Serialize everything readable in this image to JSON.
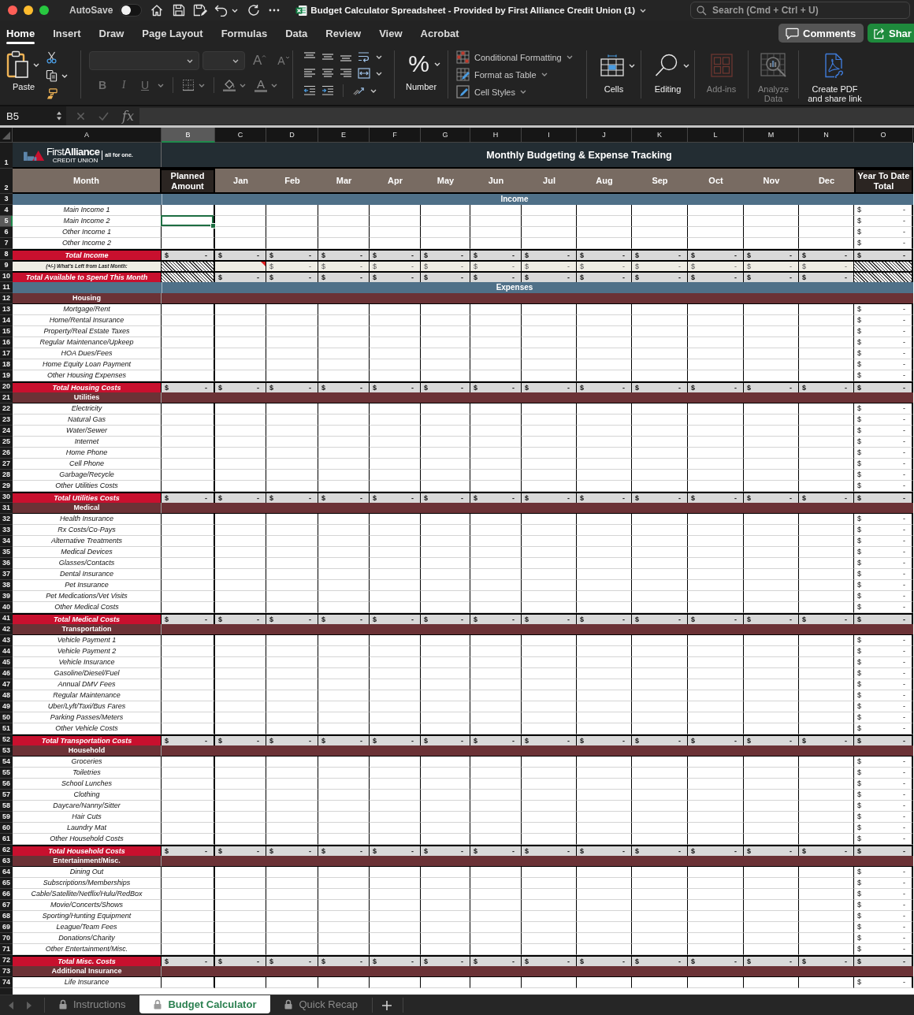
{
  "window": {
    "autosave": {
      "label": "AutoSave",
      "on": false
    },
    "title": "Budget Calculator Spreadsheet - Provided by First Alliance Credit Union (1)",
    "search": {
      "placeholder": "Search (Cmd + Ctrl + U)"
    }
  },
  "ribbon": {
    "tabs": [
      {
        "label": "Home",
        "selected": true
      },
      {
        "label": "Insert",
        "selected": false
      },
      {
        "label": "Draw",
        "selected": false
      },
      {
        "label": "Page Layout",
        "selected": false
      },
      {
        "label": "Formulas",
        "selected": false
      },
      {
        "label": "Data",
        "selected": false
      },
      {
        "label": "Review",
        "selected": false
      },
      {
        "label": "View",
        "selected": false
      },
      {
        "label": "Acrobat",
        "selected": false
      }
    ],
    "comments": "Comments",
    "share": "Shar",
    "paste": "Paste",
    "font": {
      "disabled": true,
      "grow": "A",
      "shrink": "A",
      "styles": [
        "B",
        "I",
        "U"
      ],
      "font_color_button": "A"
    },
    "number": {
      "symbol": "%",
      "label": "Number"
    },
    "styles": [
      {
        "kind": "conditional",
        "label": "Conditional Formatting"
      },
      {
        "kind": "table",
        "label": "Format as Table"
      },
      {
        "kind": "cell",
        "label": "Cell Styles"
      }
    ],
    "groups": [
      {
        "kind": "cells",
        "lines": [
          "Cells"
        ],
        "disabled": false
      },
      {
        "kind": "editing",
        "lines": [
          "Editing"
        ],
        "disabled": false
      },
      {
        "kind": "addins",
        "lines": [
          "Add-ins"
        ],
        "disabled": true
      },
      {
        "kind": "analyze",
        "lines": [
          "Analyze",
          "Data"
        ],
        "disabled": true
      },
      {
        "kind": "pdf",
        "lines": [
          "Create PDF",
          "and share link"
        ],
        "disabled": false
      }
    ]
  },
  "formula_bar": {
    "name_box": "B5",
    "function": "fx"
  },
  "sheet": {
    "columns": [
      {
        "letter": "A",
        "selected": false
      },
      {
        "letter": "B",
        "selected": true
      },
      {
        "letter": "C",
        "selected": false
      },
      {
        "letter": "D",
        "selected": false
      },
      {
        "letter": "E",
        "selected": false
      },
      {
        "letter": "F",
        "selected": false
      },
      {
        "letter": "G",
        "selected": false
      },
      {
        "letter": "H",
        "selected": false
      },
      {
        "letter": "I",
        "selected": false
      },
      {
        "letter": "J",
        "selected": false
      },
      {
        "letter": "K",
        "selected": false
      },
      {
        "letter": "L",
        "selected": false
      },
      {
        "letter": "M",
        "selected": false
      },
      {
        "letter": "N",
        "selected": false
      },
      {
        "letter": "O",
        "selected": false
      }
    ],
    "logo": {
      "wordmark": "First**Alliance**",
      "subtitle": "CREDIT UNION",
      "tagline": "all for one."
    },
    "title": "Monthly Budgeting & Expense Tracking",
    "headings": {
      "label": "Month",
      "planned": "Planned Amount",
      "months": [
        "Jan",
        "Feb",
        "Mar",
        "Apr",
        "May",
        "Jun",
        "Jul",
        "Aug",
        "Sep",
        "Oct",
        "Nov",
        "Dec"
      ],
      "total": "Year To Date Total"
    },
    "rows": [
      {
        "number": "1",
        "kind": "title",
        "selected": false
      },
      {
        "number": "2",
        "kind": "header",
        "selected": false
      },
      {
        "number": "3",
        "kind": "band",
        "selected": false,
        "label": "Income"
      },
      {
        "number": "4",
        "kind": "item",
        "selected": false,
        "label": "Main Income 1",
        "ytd": {
          "currency": "$",
          "amount": "-"
        }
      },
      {
        "number": "5",
        "kind": "item",
        "selected": true,
        "label": "Main Income 2",
        "ytd": {
          "currency": "$",
          "amount": "-"
        }
      },
      {
        "number": "6",
        "kind": "item",
        "selected": false,
        "label": "Other Income 1",
        "ytd": {
          "currency": "$",
          "amount": "-"
        }
      },
      {
        "number": "7",
        "kind": "item",
        "selected": false,
        "label": "Other Income 2",
        "ytd": {
          "currency": "$",
          "amount": "-"
        }
      },
      {
        "number": "8",
        "kind": "total",
        "selected": false,
        "label": "Total Income",
        "cells": [
          {
            "kind": "money",
            "currency": "$",
            "amount": "-"
          },
          {
            "kind": "money",
            "currency": "$",
            "amount": "-"
          },
          {
            "kind": "money",
            "currency": "$",
            "amount": "-"
          },
          {
            "kind": "money",
            "currency": "$",
            "amount": "-"
          },
          {
            "kind": "money",
            "currency": "$",
            "amount": "-"
          },
          {
            "kind": "money",
            "currency": "$",
            "amount": "-"
          },
          {
            "kind": "money",
            "currency": "$",
            "amount": "-"
          },
          {
            "kind": "money",
            "currency": "$",
            "amount": "-"
          },
          {
            "kind": "money",
            "currency": "$",
            "amount": "-"
          },
          {
            "kind": "money",
            "currency": "$",
            "amount": "-"
          },
          {
            "kind": "money",
            "currency": "$",
            "amount": "-"
          },
          {
            "kind": "money",
            "currency": "$",
            "amount": "-"
          },
          {
            "kind": "money",
            "currency": "$",
            "amount": "-"
          },
          {
            "kind": "money",
            "currency": "$",
            "amount": "-"
          }
        ]
      },
      {
        "number": "9",
        "kind": "carry",
        "selected": false,
        "label": "(+/-) What's Left from Last Month:",
        "cells": [
          {
            "kind": "hatched"
          },
          {
            "kind": "commented"
          },
          {
            "kind": "money",
            "currency": "$",
            "amount": "-"
          },
          {
            "kind": "money",
            "currency": "$",
            "amount": "-"
          },
          {
            "kind": "money",
            "currency": "$",
            "amount": "-"
          },
          {
            "kind": "money",
            "currency": "$",
            "amount": "-"
          },
          {
            "kind": "money",
            "currency": "$",
            "amount": "-"
          },
          {
            "kind": "money",
            "currency": "$",
            "amount": "-"
          },
          {
            "kind": "money",
            "currency": "$",
            "amount": "-"
          },
          {
            "kind": "money",
            "currency": "$",
            "amount": "-"
          },
          {
            "kind": "money",
            "currency": "$",
            "amount": "-"
          },
          {
            "kind": "money",
            "currency": "$",
            "amount": "-"
          },
          {
            "kind": "money",
            "currency": "$",
            "amount": "-"
          },
          {
            "kind": "hatched"
          }
        ]
      },
      {
        "number": "10",
        "kind": "total",
        "selected": false,
        "label": "Total Available to Spend This Month",
        "cells": [
          {
            "kind": "hatched"
          },
          {
            "kind": "money",
            "currency": "$",
            "amount": "-"
          },
          {
            "kind": "money",
            "currency": "$",
            "amount": "-"
          },
          {
            "kind": "money",
            "currency": "$",
            "amount": "-"
          },
          {
            "kind": "money",
            "currency": "$",
            "amount": "-"
          },
          {
            "kind": "money",
            "currency": "$",
            "amount": "-"
          },
          {
            "kind": "money",
            "currency": "$",
            "amount": "-"
          },
          {
            "kind": "money",
            "currency": "$",
            "amount": "-"
          },
          {
            "kind": "money",
            "currency": "$",
            "amount": "-"
          },
          {
            "kind": "money",
            "currency": "$",
            "amount": "-"
          },
          {
            "kind": "money",
            "currency": "$",
            "amount": "-"
          },
          {
            "kind": "money",
            "currency": "$",
            "amount": "-"
          },
          {
            "kind": "money",
            "currency": "$",
            "amount": "-"
          },
          {
            "kind": "hatched"
          }
        ]
      },
      {
        "number": "11",
        "kind": "band",
        "selected": false,
        "label": "Expenses"
      },
      {
        "number": "12",
        "kind": "category",
        "selected": false,
        "label": "Housing"
      },
      {
        "number": "13",
        "kind": "item",
        "selected": false,
        "label": "Mortgage/Rent",
        "ytd": {
          "currency": "$",
          "amount": "-"
        }
      },
      {
        "number": "14",
        "kind": "item",
        "selected": false,
        "label": "Home/Rental Insurance",
        "ytd": {
          "currency": "$",
          "amount": "-"
        }
      },
      {
        "number": "15",
        "kind": "item",
        "selected": false,
        "label": "Property/Real Estate Taxes",
        "ytd": {
          "currency": "$",
          "amount": "-"
        }
      },
      {
        "number": "16",
        "kind": "item",
        "selected": false,
        "label": "Regular Maintenance/Upkeep",
        "ytd": {
          "currency": "$",
          "amount": "-"
        }
      },
      {
        "number": "17",
        "kind": "item",
        "selected": false,
        "label": "HOA Dues/Fees",
        "ytd": {
          "currency": "$",
          "amount": "-"
        }
      },
      {
        "number": "18",
        "kind": "item",
        "selected": false,
        "label": "Home Equity Loan Payment",
        "ytd": {
          "currency": "$",
          "amount": "-"
        }
      },
      {
        "number": "19",
        "kind": "item",
        "selected": false,
        "label": "Other Housing Expenses",
        "ytd": {
          "currency": "$",
          "amount": "-"
        }
      },
      {
        "number": "20",
        "kind": "total",
        "selected": false,
        "label": "Total Housing Costs",
        "cells": [
          {
            "kind": "money",
            "currency": "$",
            "amount": "-"
          },
          {
            "kind": "money",
            "currency": "$",
            "amount": "-"
          },
          {
            "kind": "money",
            "currency": "$",
            "amount": "-"
          },
          {
            "kind": "money",
            "currency": "$",
            "amount": "-"
          },
          {
            "kind": "money",
            "currency": "$",
            "amount": "-"
          },
          {
            "kind": "money",
            "currency": "$",
            "amount": "-"
          },
          {
            "kind": "money",
            "currency": "$",
            "amount": "-"
          },
          {
            "kind": "money",
            "currency": "$",
            "amount": "-"
          },
          {
            "kind": "money",
            "currency": "$",
            "amount": "-"
          },
          {
            "kind": "money",
            "currency": "$",
            "amount": "-"
          },
          {
            "kind": "money",
            "currency": "$",
            "amount": "-"
          },
          {
            "kind": "money",
            "currency": "$",
            "amount": "-"
          },
          {
            "kind": "money",
            "currency": "$",
            "amount": "-"
          },
          {
            "kind": "money",
            "currency": "$",
            "amount": "-"
          }
        ]
      },
      {
        "number": "21",
        "kind": "category",
        "selected": false,
        "label": "Utilities"
      },
      {
        "number": "22",
        "kind": "item",
        "selected": false,
        "label": "Electricity",
        "ytd": {
          "currency": "$",
          "amount": "-"
        }
      },
      {
        "number": "23",
        "kind": "item",
        "selected": false,
        "label": "Natural Gas",
        "ytd": {
          "currency": "$",
          "amount": "-"
        }
      },
      {
        "number": "24",
        "kind": "item",
        "selected": false,
        "label": "Water/Sewer",
        "ytd": {
          "currency": "$",
          "amount": "-"
        }
      },
      {
        "number": "25",
        "kind": "item",
        "selected": false,
        "label": "Internet",
        "ytd": {
          "currency": "$",
          "amount": "-"
        }
      },
      {
        "number": "26",
        "kind": "item",
        "selected": false,
        "label": "Home Phone",
        "ytd": {
          "currency": "$",
          "amount": "-"
        }
      },
      {
        "number": "27",
        "kind": "item",
        "selected": false,
        "label": "Cell Phone",
        "ytd": {
          "currency": "$",
          "amount": "-"
        }
      },
      {
        "number": "28",
        "kind": "item",
        "selected": false,
        "label": "Garbage/Recycle",
        "ytd": {
          "currency": "$",
          "amount": "-"
        }
      },
      {
        "number": "29",
        "kind": "item",
        "selected": false,
        "label": "Other Utilities Costs",
        "ytd": {
          "currency": "$",
          "amount": "-"
        }
      },
      {
        "number": "30",
        "kind": "total",
        "selected": false,
        "label": "Total Utilities Costs",
        "cells": [
          {
            "kind": "money",
            "currency": "$",
            "amount": "-"
          },
          {
            "kind": "money",
            "currency": "$",
            "amount": "-"
          },
          {
            "kind": "money",
            "currency": "$",
            "amount": "-"
          },
          {
            "kind": "money",
            "currency": "$",
            "amount": "-"
          },
          {
            "kind": "money",
            "currency": "$",
            "amount": "-"
          },
          {
            "kind": "money",
            "currency": "$",
            "amount": "-"
          },
          {
            "kind": "money",
            "currency": "$",
            "amount": "-"
          },
          {
            "kind": "money",
            "currency": "$",
            "amount": "-"
          },
          {
            "kind": "money",
            "currency": "$",
            "amount": "-"
          },
          {
            "kind": "money",
            "currency": "$",
            "amount": "-"
          },
          {
            "kind": "money",
            "currency": "$",
            "amount": "-"
          },
          {
            "kind": "money",
            "currency": "$",
            "amount": "-"
          },
          {
            "kind": "money",
            "currency": "$",
            "amount": "-"
          },
          {
            "kind": "money",
            "currency": "$",
            "amount": "-"
          }
        ]
      },
      {
        "number": "31",
        "kind": "category",
        "selected": false,
        "label": "Medical"
      },
      {
        "number": "32",
        "kind": "item",
        "selected": false,
        "label": "Health Insurance",
        "ytd": {
          "currency": "$",
          "amount": "-"
        }
      },
      {
        "number": "33",
        "kind": "item",
        "selected": false,
        "label": "Rx Costs/Co-Pays",
        "ytd": {
          "currency": "$",
          "amount": "-"
        }
      },
      {
        "number": "34",
        "kind": "item",
        "selected": false,
        "label": "Alternative Treatments",
        "ytd": {
          "currency": "$",
          "amount": "-"
        }
      },
      {
        "number": "35",
        "kind": "item",
        "selected": false,
        "label": "Medical Devices",
        "ytd": {
          "currency": "$",
          "amount": "-"
        }
      },
      {
        "number": "36",
        "kind": "item",
        "selected": false,
        "label": "Glasses/Contacts",
        "ytd": {
          "currency": "$",
          "amount": "-"
        }
      },
      {
        "number": "37",
        "kind": "item",
        "selected": false,
        "label": "Dental Insurance",
        "ytd": {
          "currency": "$",
          "amount": "-"
        }
      },
      {
        "number": "38",
        "kind": "item",
        "selected": false,
        "label": "Pet Insurance",
        "ytd": {
          "currency": "$",
          "amount": "-"
        }
      },
      {
        "number": "39",
        "kind": "item",
        "selected": false,
        "label": "Pet Medications/Vet Visits",
        "ytd": {
          "currency": "$",
          "amount": "-"
        }
      },
      {
        "number": "40",
        "kind": "item",
        "selected": false,
        "label": "Other Medical Costs",
        "ytd": {
          "currency": "$",
          "amount": "-"
        }
      },
      {
        "number": "41",
        "kind": "total",
        "selected": false,
        "label": "Total Medical Costs",
        "cells": [
          {
            "kind": "money",
            "currency": "$",
            "amount": "-"
          },
          {
            "kind": "money",
            "currency": "$",
            "amount": "-"
          },
          {
            "kind": "money",
            "currency": "$",
            "amount": "-"
          },
          {
            "kind": "money",
            "currency": "$",
            "amount": "-"
          },
          {
            "kind": "money",
            "currency": "$",
            "amount": "-"
          },
          {
            "kind": "money",
            "currency": "$",
            "amount": "-"
          },
          {
            "kind": "money",
            "currency": "$",
            "amount": "-"
          },
          {
            "kind": "money",
            "currency": "$",
            "amount": "-"
          },
          {
            "kind": "money",
            "currency": "$",
            "amount": "-"
          },
          {
            "kind": "money",
            "currency": "$",
            "amount": "-"
          },
          {
            "kind": "money",
            "currency": "$",
            "amount": "-"
          },
          {
            "kind": "money",
            "currency": "$",
            "amount": "-"
          },
          {
            "kind": "money",
            "currency": "$",
            "amount": "-"
          },
          {
            "kind": "money",
            "currency": "$",
            "amount": "-"
          }
        ]
      },
      {
        "number": "42",
        "kind": "category",
        "selected": false,
        "label": "Transportation"
      },
      {
        "number": "43",
        "kind": "item",
        "selected": false,
        "label": "Vehicle Payment 1",
        "ytd": {
          "currency": "$",
          "amount": "-"
        }
      },
      {
        "number": "44",
        "kind": "item",
        "selected": false,
        "label": "Vehicle Payment 2",
        "ytd": {
          "currency": "$",
          "amount": "-"
        }
      },
      {
        "number": "45",
        "kind": "item",
        "selected": false,
        "label": "Vehicle Insurance",
        "ytd": {
          "currency": "$",
          "amount": "-"
        }
      },
      {
        "number": "46",
        "kind": "item",
        "selected": false,
        "label": "Gasoline/Diesel/Fuel",
        "ytd": {
          "currency": "$",
          "amount": "-"
        }
      },
      {
        "number": "47",
        "kind": "item",
        "selected": false,
        "label": "Annual DMV Fees",
        "ytd": {
          "currency": "$",
          "amount": "-"
        }
      },
      {
        "number": "48",
        "kind": "item",
        "selected": false,
        "label": "Regular Maintenance",
        "ytd": {
          "currency": "$",
          "amount": "-"
        }
      },
      {
        "number": "49",
        "kind": "item",
        "selected": false,
        "label": "Uber/Lyft/Taxi/Bus Fares",
        "ytd": {
          "currency": "$",
          "amount": "-"
        }
      },
      {
        "number": "50",
        "kind": "item",
        "selected": false,
        "label": "Parking Passes/Meters",
        "ytd": {
          "currency": "$",
          "amount": "-"
        }
      },
      {
        "number": "51",
        "kind": "item",
        "selected": false,
        "label": "Other Vehicle Costs",
        "ytd": {
          "currency": "$",
          "amount": "-"
        }
      },
      {
        "number": "52",
        "kind": "total",
        "selected": false,
        "label": "Total Transportation Costs",
        "cells": [
          {
            "kind": "money",
            "currency": "$",
            "amount": "-"
          },
          {
            "kind": "money",
            "currency": "$",
            "amount": "-"
          },
          {
            "kind": "money",
            "currency": "$",
            "amount": "-"
          },
          {
            "kind": "money",
            "currency": "$",
            "amount": "-"
          },
          {
            "kind": "money",
            "currency": "$",
            "amount": "-"
          },
          {
            "kind": "money",
            "currency": "$",
            "amount": "-"
          },
          {
            "kind": "money",
            "currency": "$",
            "amount": "-"
          },
          {
            "kind": "money",
            "currency": "$",
            "amount": "-"
          },
          {
            "kind": "money",
            "currency": "$",
            "amount": "-"
          },
          {
            "kind": "money",
            "currency": "$",
            "amount": "-"
          },
          {
            "kind": "money",
            "currency": "$",
            "amount": "-"
          },
          {
            "kind": "money",
            "currency": "$",
            "amount": "-"
          },
          {
            "kind": "money",
            "currency": "$",
            "amount": "-"
          },
          {
            "kind": "money",
            "currency": "$",
            "amount": "-"
          }
        ]
      },
      {
        "number": "53",
        "kind": "category",
        "selected": false,
        "label": "Household"
      },
      {
        "number": "54",
        "kind": "item",
        "selected": false,
        "label": "Groceries",
        "ytd": {
          "currency": "$",
          "amount": "-"
        }
      },
      {
        "number": "55",
        "kind": "item",
        "selected": false,
        "label": "Toiletries",
        "ytd": {
          "currency": "$",
          "amount": "-"
        }
      },
      {
        "number": "56",
        "kind": "item",
        "selected": false,
        "label": "School Lunches",
        "ytd": {
          "currency": "$",
          "amount": "-"
        }
      },
      {
        "number": "57",
        "kind": "item",
        "selected": false,
        "label": "Clothing",
        "ytd": {
          "currency": "$",
          "amount": "-"
        }
      },
      {
        "number": "58",
        "kind": "item",
        "selected": false,
        "label": "Daycare/Nanny/Sitter",
        "ytd": {
          "currency": "$",
          "amount": "-"
        }
      },
      {
        "number": "59",
        "kind": "item",
        "selected": false,
        "label": "Hair Cuts",
        "ytd": {
          "currency": "$",
          "amount": "-"
        }
      },
      {
        "number": "60",
        "kind": "item",
        "selected": false,
        "label": "Laundry Mat",
        "ytd": {
          "currency": "$",
          "amount": "-"
        }
      },
      {
        "number": "61",
        "kind": "item",
        "selected": false,
        "label": "Other Household Costs",
        "ytd": {
          "currency": "$",
          "amount": "-"
        }
      },
      {
        "number": "62",
        "kind": "total",
        "selected": false,
        "label": "Total Household Costs",
        "cells": [
          {
            "kind": "money",
            "currency": "$",
            "amount": "-"
          },
          {
            "kind": "money",
            "currency": "$",
            "amount": "-"
          },
          {
            "kind": "money",
            "currency": "$",
            "amount": "-"
          },
          {
            "kind": "money",
            "currency": "$",
            "amount": "-"
          },
          {
            "kind": "money",
            "currency": "$",
            "amount": "-"
          },
          {
            "kind": "money",
            "currency": "$",
            "amount": "-"
          },
          {
            "kind": "money",
            "currency": "$",
            "amount": "-"
          },
          {
            "kind": "money",
            "currency": "$",
            "amount": "-"
          },
          {
            "kind": "money",
            "currency": "$",
            "amount": "-"
          },
          {
            "kind": "money",
            "currency": "$",
            "amount": "-"
          },
          {
            "kind": "money",
            "currency": "$",
            "amount": "-"
          },
          {
            "kind": "money",
            "currency": "$",
            "amount": "-"
          },
          {
            "kind": "money",
            "currency": "$",
            "amount": "-"
          },
          {
            "kind": "money",
            "currency": "$",
            "amount": "-"
          }
        ]
      },
      {
        "number": "63",
        "kind": "category",
        "selected": false,
        "label": "Entertainment/Misc."
      },
      {
        "number": "64",
        "kind": "item",
        "selected": false,
        "label": "Dining Out",
        "ytd": {
          "currency": "$",
          "amount": "-"
        }
      },
      {
        "number": "65",
        "kind": "item",
        "selected": false,
        "label": "Subscriptions/Memberships",
        "ytd": {
          "currency": "$",
          "amount": "-"
        }
      },
      {
        "number": "66",
        "kind": "item",
        "selected": false,
        "label": "Cable/Satellite/Netflix/Hulu/RedBox",
        "ytd": {
          "currency": "$",
          "amount": "-"
        }
      },
      {
        "number": "67",
        "kind": "item",
        "selected": false,
        "label": "Movie/Concerts/Shows",
        "ytd": {
          "currency": "$",
          "amount": "-"
        }
      },
      {
        "number": "68",
        "kind": "item",
        "selected": false,
        "label": "Sporting/Hunting Equipment",
        "ytd": {
          "currency": "$",
          "amount": "-"
        }
      },
      {
        "number": "69",
        "kind": "item",
        "selected": false,
        "label": "League/Team Fees",
        "ytd": {
          "currency": "$",
          "amount": "-"
        }
      },
      {
        "number": "70",
        "kind": "item",
        "selected": false,
        "label": "Donations/Charity",
        "ytd": {
          "currency": "$",
          "amount": "-"
        }
      },
      {
        "number": "71",
        "kind": "item",
        "selected": false,
        "label": "Other Entertainment/Misc.",
        "ytd": {
          "currency": "$",
          "amount": "-"
        }
      },
      {
        "number": "72",
        "kind": "total",
        "selected": false,
        "label": "Total Misc. Costs",
        "cells": [
          {
            "kind": "money",
            "currency": "$",
            "amount": "-"
          },
          {
            "kind": "money",
            "currency": "$",
            "amount": "-"
          },
          {
            "kind": "money",
            "currency": "$",
            "amount": "-"
          },
          {
            "kind": "money",
            "currency": "$",
            "amount": "-"
          },
          {
            "kind": "money",
            "currency": "$",
            "amount": "-"
          },
          {
            "kind": "money",
            "currency": "$",
            "amount": "-"
          },
          {
            "kind": "money",
            "currency": "$",
            "amount": "-"
          },
          {
            "kind": "money",
            "currency": "$",
            "amount": "-"
          },
          {
            "kind": "money",
            "currency": "$",
            "amount": "-"
          },
          {
            "kind": "money",
            "currency": "$",
            "amount": "-"
          },
          {
            "kind": "money",
            "currency": "$",
            "amount": "-"
          },
          {
            "kind": "money",
            "currency": "$",
            "amount": "-"
          },
          {
            "kind": "money",
            "currency": "$",
            "amount": "-"
          },
          {
            "kind": "money",
            "currency": "$",
            "amount": "-"
          }
        ]
      },
      {
        "number": "73",
        "kind": "category",
        "selected": false,
        "label": "Additional Insurance"
      },
      {
        "number": "74",
        "kind": "item",
        "selected": false,
        "label": "Life Insurance",
        "ytd": {
          "currency": "$",
          "amount": "-"
        }
      }
    ]
  },
  "sheet_tabs": [
    {
      "label": "Instructions",
      "selected": false,
      "locked": true
    },
    {
      "label": "Budget Calculator",
      "selected": true,
      "locked": true
    },
    {
      "label": "Quick Recap",
      "selected": false,
      "locked": true
    }
  ]
}
